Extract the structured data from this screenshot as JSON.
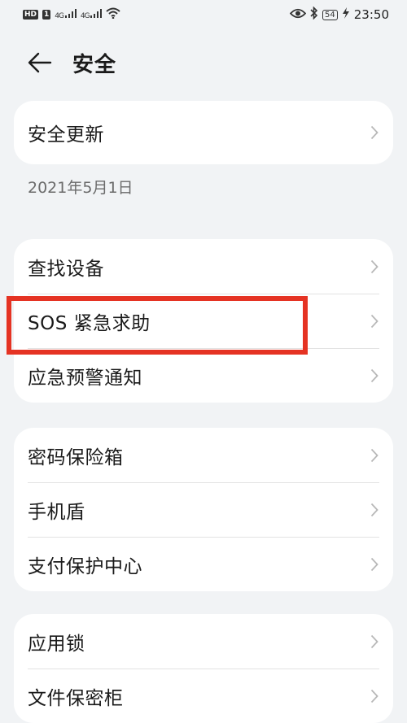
{
  "status_bar": {
    "hd_badge": "HD",
    "sim_badge": "1",
    "signal1": "4G",
    "signal2": "4G",
    "battery": "54",
    "time": "23:50"
  },
  "header": {
    "title": "安全"
  },
  "security_update": {
    "label": "安全更新",
    "date": "2021年5月1日"
  },
  "group1": [
    {
      "label": "查找设备"
    },
    {
      "label": "SOS 紧急求助"
    },
    {
      "label": "应急预警通知"
    }
  ],
  "group2": [
    {
      "label": "密码保险箱"
    },
    {
      "label": "手机盾"
    },
    {
      "label": "支付保护中心"
    }
  ],
  "group3": [
    {
      "label": "应用锁"
    },
    {
      "label": "文件保密柜"
    }
  ],
  "annotation": {
    "highlight_color": "#e53323",
    "highlighted_item": "SOS 紧急求助"
  }
}
